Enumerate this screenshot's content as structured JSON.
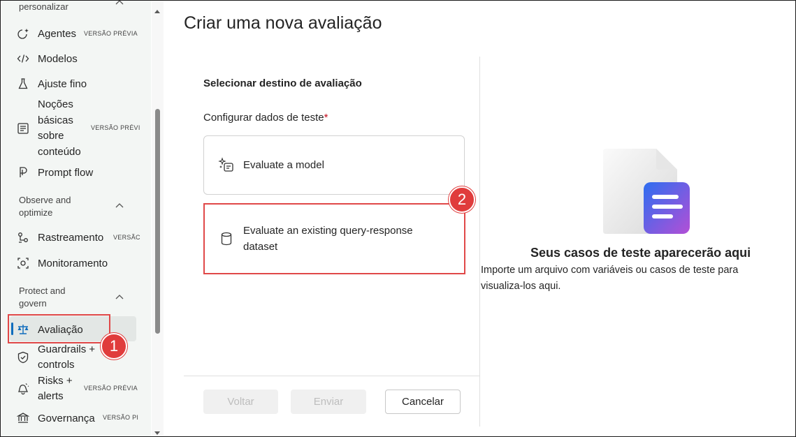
{
  "sidebar": {
    "top_partial_label": "personalizar",
    "items": [
      {
        "label": "Agentes",
        "badge": "VERSÃO PRÉVIA",
        "icon": "sparkle-agent-icon"
      },
      {
        "label": "Modelos",
        "icon": "code-icon"
      },
      {
        "label": "Ajuste fino",
        "icon": "flask-icon"
      },
      {
        "label_lines": [
          "Noções",
          "básicas",
          "sobre",
          "conteúdo"
        ],
        "badge": "VERSÃO PRÉVI",
        "icon": "content-list-icon"
      },
      {
        "label": "Prompt flow",
        "icon": "prompt-flow-icon"
      }
    ],
    "section_observe": {
      "title_lines": [
        "Observe and",
        "optimize"
      ]
    },
    "observe_items": [
      {
        "label": "Rastreamento",
        "badge": "VERSÃC",
        "icon": "tracing-icon"
      },
      {
        "label": "Monitoramento",
        "icon": "monitor-icon"
      }
    ],
    "section_protect": {
      "title_lines": [
        "Protect and",
        "govern"
      ]
    },
    "protect_items": [
      {
        "label": "Avaliação",
        "icon": "scale-icon",
        "active": true
      },
      {
        "label_lines": [
          "Guardrails +",
          "controls"
        ],
        "icon": "shield-icon"
      },
      {
        "label_lines": [
          "Risks +",
          "alerts"
        ],
        "badge": "VERSÃO PRÉVIA",
        "icon": "alert-bell-icon"
      },
      {
        "label": "Governança",
        "badge": "VERSÃO PI",
        "icon": "bank-icon"
      }
    ]
  },
  "callouts": {
    "one": "1",
    "two": "2"
  },
  "main": {
    "title": "Criar uma nova avaliação",
    "section_heading": "Selecionar destino de avaliação",
    "field_label": "Configurar dados de teste",
    "required_mark": "*",
    "options": [
      {
        "label": "Evaluate a model",
        "icon": "sparkle-model-icon"
      },
      {
        "label_lines": [
          "Evaluate an existing query-response",
          "dataset"
        ],
        "icon": "database-icon"
      }
    ],
    "buttons": {
      "back": "Voltar",
      "submit": "Enviar",
      "cancel": "Cancelar"
    }
  },
  "empty_state": {
    "title": "Seus casos de teste aparecerão aqui",
    "description_lines": [
      "Importe um arquivo com variáveis ou casos de teste para",
      "visualiza-los aqui."
    ],
    "accent_gradient": [
      "#2d6ef0",
      "#b34fd6"
    ]
  }
}
